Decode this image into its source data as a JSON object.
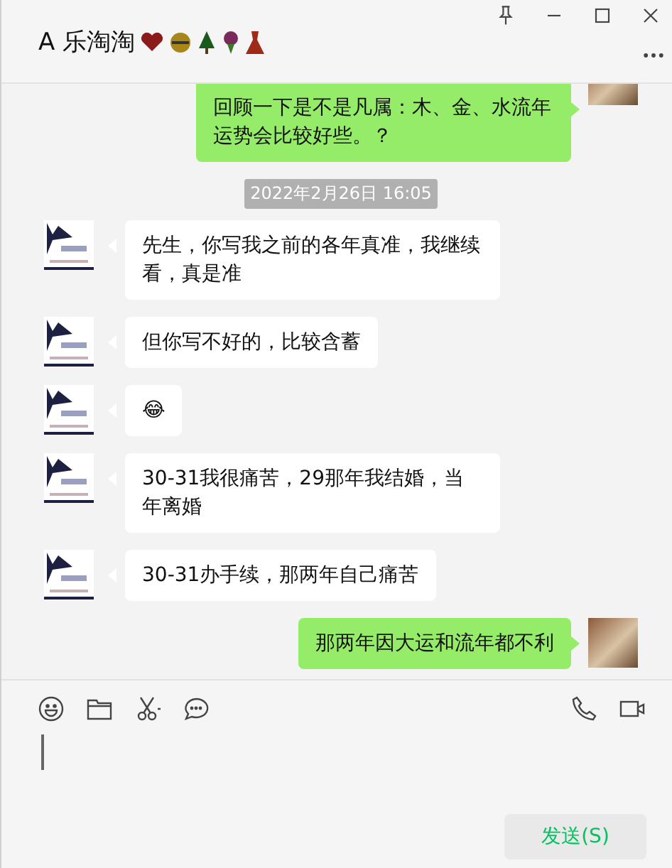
{
  "window": {
    "title": "A 乐淘淘"
  },
  "messages": [
    {
      "kind": "sent",
      "text": "回顾一下是不是凡属：木、金、水流年运势会比较好些。？"
    },
    {
      "kind": "time",
      "text": "2022年2月26日 16:05"
    },
    {
      "kind": "received",
      "text": " 先生，你写我之前的各年真准，我继续看，真是准"
    },
    {
      "kind": "received",
      "text": "但你写不好的，比较含蓄"
    },
    {
      "kind": "received",
      "text": "😂"
    },
    {
      "kind": "received",
      "text": "30-31我很痛苦，29那年我结婚，当年离婚"
    },
    {
      "kind": "received",
      "text": "30-31办手续，那两年自己痛苦"
    },
    {
      "kind": "sent",
      "text": "那两年因大运和流年都不利"
    }
  ],
  "send_button": "发送(S)"
}
